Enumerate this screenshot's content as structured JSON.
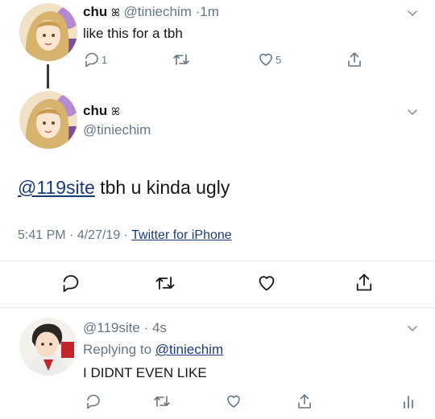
{
  "tweet1": {
    "name": "chu",
    "name_glyph": "ꕤ",
    "handle": "@tiniechim",
    "sep": "·",
    "time": "1m",
    "text": "like this for a tbh",
    "reply_count": "1",
    "like_count": "5"
  },
  "main": {
    "name": "chu",
    "name_glyph": "ꕤ",
    "handle": "@tiniechim",
    "mention": "@119site",
    "text": " tbh u kinda ugly",
    "time": "5:41 PM",
    "date": "4/27/19",
    "sep": "·",
    "source": "Twitter for iPhone"
  },
  "reply": {
    "handle": "@119site",
    "sep": "·",
    "time": "4s",
    "replying_prefix": "Replying to ",
    "replying_to": "@tiniechim",
    "text": "I DIDNT EVEN LIKE"
  },
  "icons": {
    "reply": "reply-icon",
    "retweet": "retweet-icon",
    "like": "heart-icon",
    "share": "share-icon",
    "analytics": "analytics-icon",
    "more": "chevron-down-icon"
  },
  "colors": {
    "link": "#1b3a7a",
    "muted": "#657786",
    "divider": "#e6ecf0"
  }
}
